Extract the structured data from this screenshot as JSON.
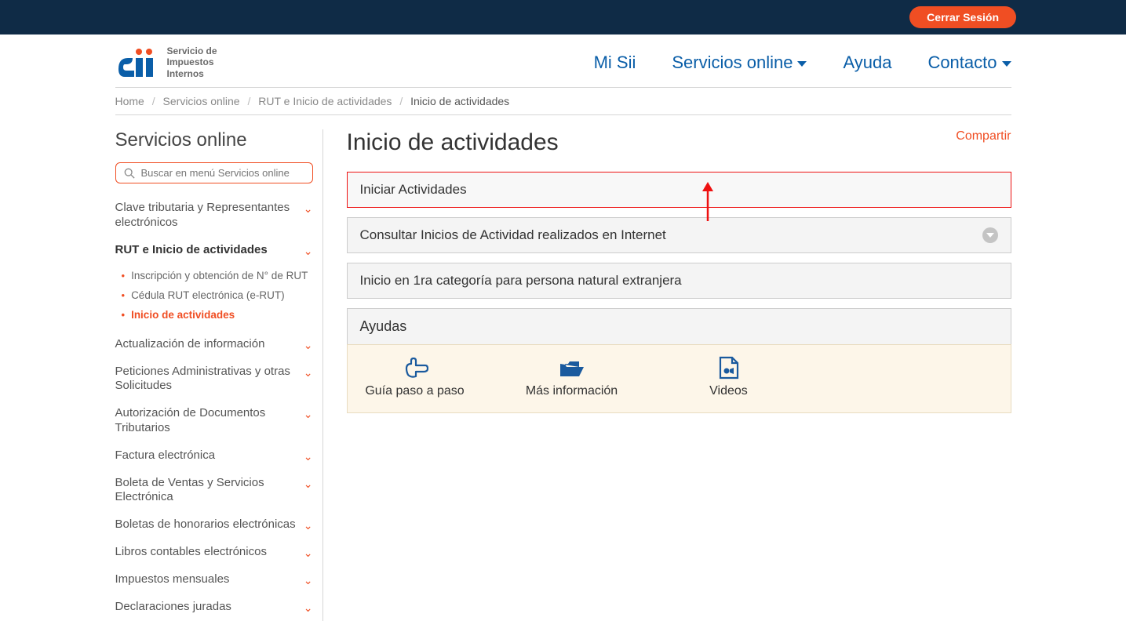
{
  "topbar": {
    "logout": "Cerrar Sesión"
  },
  "brand": {
    "line1": "Servicio de",
    "line2": "Impuestos",
    "line3": "Internos"
  },
  "nav": {
    "misii": "Mi Sii",
    "servicios": "Servicios online",
    "ayuda": "Ayuda",
    "contacto": "Contacto"
  },
  "breadcrumb": {
    "c1": "Home",
    "c2": "Servicios online",
    "c3": "RUT e Inicio de actividades",
    "c4": "Inicio de actividades"
  },
  "sidebar": {
    "title": "Servicios online",
    "search_placeholder": "Buscar en menú Servicios online",
    "items": {
      "clave": "Clave tributaria y Representantes electrónicos",
      "rut": "RUT e Inicio de actividades",
      "sub_inscripcion": "Inscripción y obtención de N° de RUT",
      "sub_cedula": "Cédula RUT electrónica (e-RUT)",
      "sub_inicio": "Inicio de actividades",
      "actualizacion": "Actualización de información",
      "peticiones": "Peticiones Administrativas y otras Solicitudes",
      "autorizacion": "Autorización de Documentos Tributarios",
      "factura": "Factura electrónica",
      "boleta_ventas": "Boleta de Ventas y Servicios Electrónica",
      "boletas_honorarios": "Boletas de honorarios electrónicas",
      "libros": "Libros contables electrónicos",
      "impuestos": "Impuestos mensuales",
      "declaraciones": "Declaraciones juradas"
    }
  },
  "content": {
    "share": "Compartir",
    "title": "Inicio de actividades",
    "panel_iniciar": "Iniciar Actividades",
    "panel_consultar": "Consultar Inicios de Actividad realizados en Internet",
    "panel_extranjera": "Inicio en 1ra categoría para persona natural extranjera",
    "ayudas_title": "Ayudas",
    "ayuda_guia": "Guía paso a paso",
    "ayuda_info": "Más información",
    "ayuda_videos": "Videos"
  }
}
